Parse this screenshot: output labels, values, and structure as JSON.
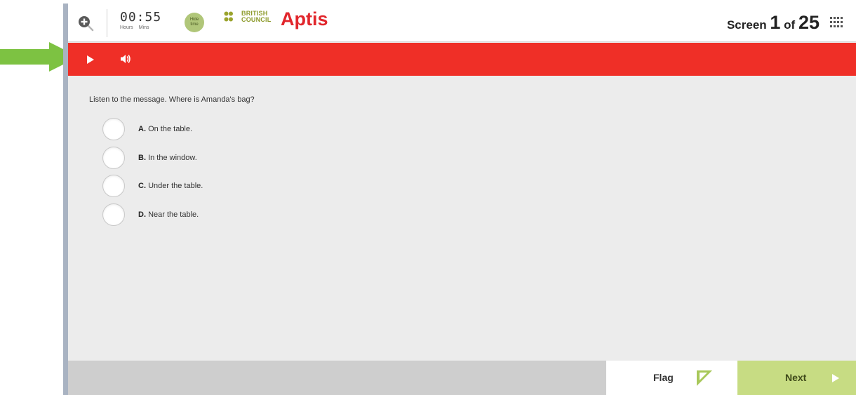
{
  "header": {
    "timer": {
      "value": "00:55",
      "hours_label": "Hours",
      "mins_label": "Mins"
    },
    "hide_time": {
      "line1": "Hide",
      "line2": "time"
    },
    "brand": {
      "line1": "BRITISH",
      "line2": "COUNCIL",
      "product": "Aptis"
    },
    "screen_counter": {
      "prefix": "Screen",
      "current": "1",
      "of_label": "of",
      "total": "25"
    }
  },
  "question": {
    "prompt": "Listen to the message. Where is Amanda's bag?",
    "options": [
      {
        "letter": "A.",
        "text": "On the table."
      },
      {
        "letter": "B.",
        "text": "In the window."
      },
      {
        "letter": "C.",
        "text": "Under the table."
      },
      {
        "letter": "D.",
        "text": "Near the table."
      }
    ]
  },
  "footer": {
    "flag_label": "Flag",
    "next_label": "Next"
  },
  "icons": {
    "zoom": "zoom-in-icon",
    "play": "play-icon",
    "volume": "volume-icon",
    "grid": "grid-icon",
    "flag": "flag-icon",
    "next": "chevron-right-icon",
    "annotation": "arrow-right-icon"
  },
  "colors": {
    "brand_red": "#ef2f27",
    "aptis_red": "#e1262c",
    "annotation_green": "#7dc242",
    "next_green": "#c7dc83",
    "hide_time_green": "#b0c679",
    "background": "#ececec"
  }
}
